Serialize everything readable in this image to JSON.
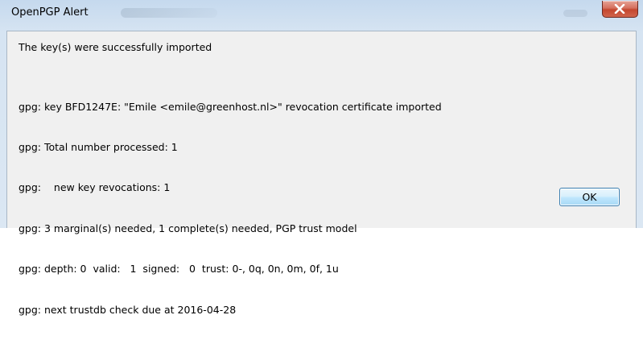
{
  "window": {
    "title": "OpenPGP Alert",
    "close_icon": "close-icon"
  },
  "message": {
    "headline": "The key(s) were successfully imported",
    "lines": [
      "gpg: key BFD1247E: \"Emile <emile@greenhost.nl>\" revocation certificate imported",
      "gpg: Total number processed: 1",
      "gpg:    new key revocations: 1",
      "gpg: 3 marginal(s) needed, 1 complete(s) needed, PGP trust model",
      "gpg: depth: 0  valid:   1  signed:   0  trust: 0-, 0q, 0n, 0m, 0f, 1u",
      "gpg: next trustdb check due at 2016-04-28"
    ]
  },
  "buttons": {
    "ok_label": "OK"
  },
  "colors": {
    "close_button": "#c4472f",
    "ok_border": "#3c7fb1",
    "titlebar": "#c5d9ee",
    "client_bg": "#f0f0f0"
  }
}
